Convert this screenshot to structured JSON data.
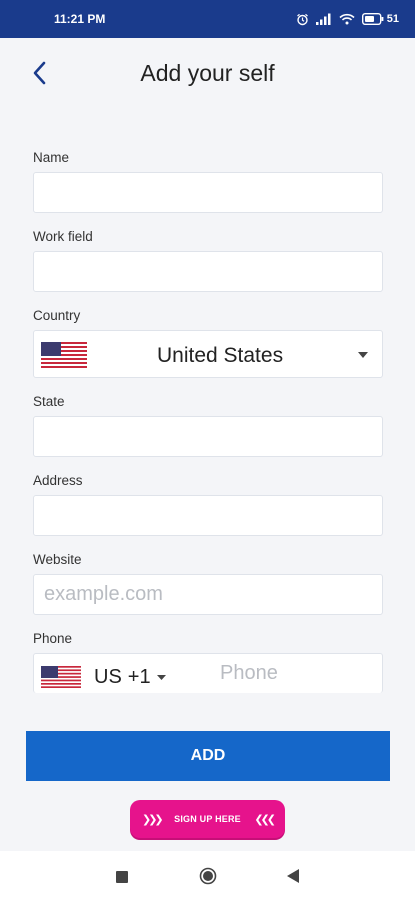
{
  "status_bar": {
    "time": "11:21 PM",
    "battery": "51"
  },
  "header": {
    "title": "Add your self"
  },
  "form": {
    "name": {
      "label": "Name",
      "value": "",
      "placeholder": ""
    },
    "work_field": {
      "label": "Work field",
      "value": "",
      "placeholder": ""
    },
    "country": {
      "label": "Country",
      "selected": "United States",
      "flag": "us-flag-icon"
    },
    "state": {
      "label": "State",
      "value": "",
      "placeholder": ""
    },
    "address": {
      "label": "Address",
      "value": "",
      "placeholder": ""
    },
    "website": {
      "label": "Website",
      "value": "",
      "placeholder": "example.com"
    },
    "phone": {
      "label": "Phone",
      "country_code": "US",
      "dial_code": "+1",
      "value": "",
      "placeholder": "Phone"
    }
  },
  "actions": {
    "add_label": "ADD"
  },
  "banner": {
    "text": "SIGN UP HERE",
    "color": "#e6138c"
  },
  "colors": {
    "status_bar": "#1a3b8c",
    "primary_button": "#1567c9",
    "back_arrow": "#1a3b8c"
  },
  "nav_bar": {
    "icons": [
      "recent-apps-icon",
      "home-icon",
      "back-triangle-icon"
    ]
  }
}
